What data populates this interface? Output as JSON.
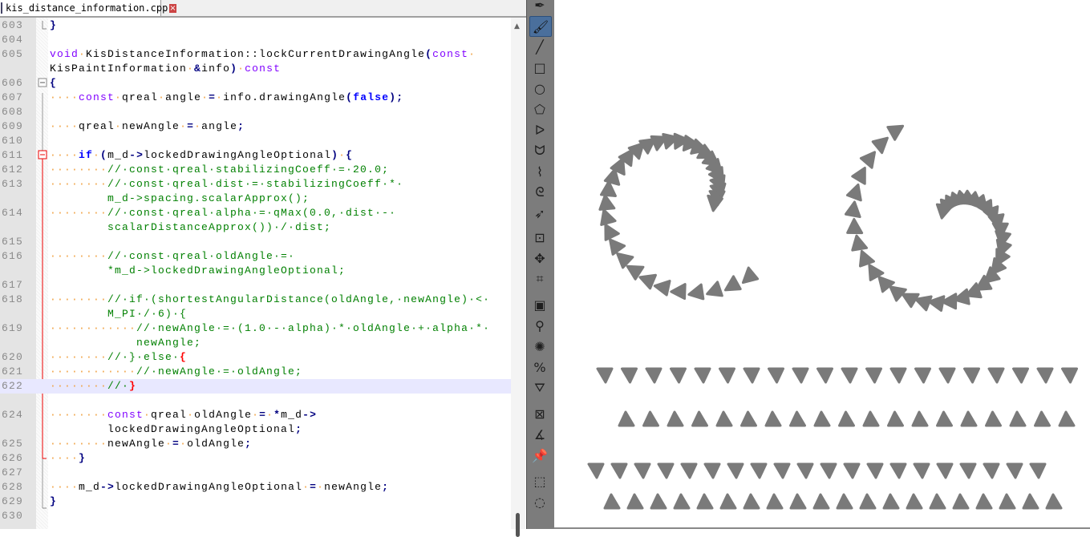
{
  "tab": {
    "filename": "kis_distance_information.cpp"
  },
  "colors": {
    "keyword": "#8000ff",
    "keyword_bold": "#0000ff",
    "comment": "#008000",
    "operator": "#000080",
    "whitespace": "#f0a040",
    "current_line": "#e8e8ff",
    "brush_dab": "#7a7a7a",
    "toolbox": "#7c7c7c",
    "active_tool": "#4a6f9c"
  },
  "code_rows": [
    {
      "n": "603",
      "s": [
        [
          "}",
          "op"
        ]
      ]
    },
    {
      "n": "604",
      "s": []
    },
    {
      "n": "605",
      "s": [
        [
          "void",
          "kw"
        ],
        [
          "·",
          "ws"
        ],
        [
          "KisDistanceInformation::lockCurrentDrawingAngle",
          "id"
        ],
        [
          "(",
          "op"
        ],
        [
          "const",
          "kw"
        ],
        [
          "·",
          "ws"
        ]
      ]
    },
    {
      "n": "",
      "s": [
        [
          "KisPaintInformation",
          "id"
        ],
        [
          "·",
          "ws"
        ],
        [
          "&",
          "op"
        ],
        [
          "info",
          "id"
        ],
        [
          ")",
          "op"
        ],
        [
          "·",
          "ws"
        ],
        [
          "const",
          "kw"
        ]
      ]
    },
    {
      "n": "606",
      "s": [
        [
          "{",
          "op"
        ]
      ]
    },
    {
      "n": "607",
      "s": [
        [
          "····",
          "ws"
        ],
        [
          "const",
          "kw"
        ],
        [
          "·",
          "ws"
        ],
        [
          "qreal",
          "id"
        ],
        [
          "·",
          "ws"
        ],
        [
          "angle",
          "id"
        ],
        [
          "·",
          "ws"
        ],
        [
          "=",
          "op"
        ],
        [
          "·",
          "ws"
        ],
        [
          "info.drawingAngle",
          "id"
        ],
        [
          "(",
          "op"
        ],
        [
          "false",
          "kb"
        ],
        [
          ");",
          "op"
        ]
      ]
    },
    {
      "n": "608",
      "s": []
    },
    {
      "n": "609",
      "s": [
        [
          "····",
          "ws"
        ],
        [
          "qreal",
          "id"
        ],
        [
          "·",
          "ws"
        ],
        [
          "newAngle",
          "id"
        ],
        [
          "·",
          "ws"
        ],
        [
          "=",
          "op"
        ],
        [
          "·",
          "ws"
        ],
        [
          "angle",
          "id"
        ],
        [
          ";",
          "op"
        ]
      ]
    },
    {
      "n": "610",
      "s": []
    },
    {
      "n": "611",
      "s": [
        [
          "····",
          "ws"
        ],
        [
          "if",
          "kb"
        ],
        [
          "·",
          "ws"
        ],
        [
          "(",
          "op"
        ],
        [
          "m_d",
          "id"
        ],
        [
          "->",
          "op"
        ],
        [
          "lockedDrawingAngleOptional",
          "id"
        ],
        [
          ")",
          "op"
        ],
        [
          "·",
          "ws"
        ],
        [
          "{",
          "op"
        ]
      ]
    },
    {
      "n": "612",
      "s": [
        [
          "········",
          "ws"
        ],
        [
          "//·const·qreal·stabilizingCoeff·=·20.0;",
          "cm"
        ]
      ]
    },
    {
      "n": "613",
      "s": [
        [
          "········",
          "ws"
        ],
        [
          "//·const·qreal·dist·=·stabilizingCoeff·*·",
          "cm"
        ]
      ]
    },
    {
      "n": "",
      "s": [
        [
          "        ",
          "id"
        ],
        [
          "m_d->spacing.scalarApprox();",
          "cm"
        ]
      ]
    },
    {
      "n": "614",
      "s": [
        [
          "········",
          "ws"
        ],
        [
          "//·const·qreal·alpha·=·qMax(0.0,·dist·-·",
          "cm"
        ]
      ]
    },
    {
      "n": "",
      "s": [
        [
          "        ",
          "id"
        ],
        [
          "scalarDistanceApprox())·/·dist;",
          "cm"
        ]
      ]
    },
    {
      "n": "615",
      "s": []
    },
    {
      "n": "616",
      "s": [
        [
          "········",
          "ws"
        ],
        [
          "//·const·qreal·oldAngle·=·",
          "cm"
        ]
      ]
    },
    {
      "n": "",
      "s": [
        [
          "        ",
          "id"
        ],
        [
          "*m_d->lockedDrawingAngleOptional;",
          "cm"
        ]
      ]
    },
    {
      "n": "617",
      "s": []
    },
    {
      "n": "618",
      "s": [
        [
          "········",
          "ws"
        ],
        [
          "//·if·(shortestAngularDistance(oldAngle,·newAngle)·<·",
          "cm"
        ]
      ]
    },
    {
      "n": "",
      "s": [
        [
          "        ",
          "id"
        ],
        [
          "M_PI·/·6)·{",
          "cm"
        ]
      ]
    },
    {
      "n": "619",
      "s": [
        [
          "············",
          "ws"
        ],
        [
          "//·newAngle·=·(1.0·-·alpha)·*·oldAngle·+·alpha·*·",
          "cm"
        ]
      ]
    },
    {
      "n": "",
      "s": [
        [
          "            ",
          "id"
        ],
        [
          "newAngle;",
          "cm"
        ]
      ]
    },
    {
      "n": "620",
      "s": [
        [
          "········",
          "ws"
        ],
        [
          "//·}·else·",
          "cm"
        ],
        [
          "{",
          "br"
        ]
      ]
    },
    {
      "n": "621",
      "s": [
        [
          "············",
          "ws"
        ],
        [
          "//·newAngle·=·oldAngle;",
          "cm"
        ]
      ]
    },
    {
      "n": "622",
      "s": [
        [
          "········",
          "ws"
        ],
        [
          "//·",
          "cm"
        ],
        [
          "}",
          "br"
        ]
      ],
      "current": true
    },
    {
      "n": "",
      "s": []
    },
    {
      "n": "624",
      "s": [
        [
          "········",
          "ws"
        ],
        [
          "const",
          "kw"
        ],
        [
          "·",
          "ws"
        ],
        [
          "qreal",
          "id"
        ],
        [
          "·",
          "ws"
        ],
        [
          "oldAngle",
          "id"
        ],
        [
          "·",
          "ws"
        ],
        [
          "=",
          "op"
        ],
        [
          "·",
          "ws"
        ],
        [
          "*",
          "op"
        ],
        [
          "m_d",
          "id"
        ],
        [
          "->",
          "op"
        ]
      ]
    },
    {
      "n": "",
      "s": [
        [
          "        ",
          "id"
        ],
        [
          "lockedDrawingAngleOptional",
          "id"
        ],
        [
          ";",
          "op"
        ]
      ]
    },
    {
      "n": "625",
      "s": [
        [
          "········",
          "ws"
        ],
        [
          "newAngle",
          "id"
        ],
        [
          "·",
          "ws"
        ],
        [
          "=",
          "op"
        ],
        [
          "·",
          "ws"
        ],
        [
          "oldAngle",
          "id"
        ],
        [
          ";",
          "op"
        ]
      ]
    },
    {
      "n": "626",
      "s": [
        [
          "····",
          "ws"
        ],
        [
          "}",
          "op"
        ]
      ]
    },
    {
      "n": "627",
      "s": []
    },
    {
      "n": "628",
      "s": [
        [
          "····",
          "ws"
        ],
        [
          "m_d",
          "id"
        ],
        [
          "->",
          "op"
        ],
        [
          "lockedDrawingAngleOptional",
          "id"
        ],
        [
          "·",
          "ws"
        ],
        [
          "=",
          "op"
        ],
        [
          "·",
          "ws"
        ],
        [
          "newAngle",
          "id"
        ],
        [
          ";",
          "op"
        ]
      ]
    },
    {
      "n": "629",
      "s": [
        [
          "}",
          "op"
        ]
      ]
    },
    {
      "n": "630",
      "s": []
    }
  ],
  "tools": [
    {
      "name": "calligraphy-tool",
      "glyph": "✒"
    },
    {
      "name": "freehand-brush-tool",
      "glyph": "🖌",
      "active": true
    },
    {
      "name": "line-tool",
      "glyph": "╱"
    },
    {
      "name": "rectangle-tool",
      "glyph": "□"
    },
    {
      "name": "ellipse-tool",
      "glyph": "○"
    },
    {
      "name": "polygon-tool",
      "glyph": "⬠"
    },
    {
      "name": "polyline-tool",
      "glyph": "ᐅ"
    },
    {
      "name": "bezier-curve-tool",
      "glyph": "ᗢ"
    },
    {
      "name": "freehand-path-tool",
      "glyph": "⌇"
    },
    {
      "name": "dynamic-brush-tool",
      "glyph": "ᘓ"
    },
    {
      "name": "multibrush-tool",
      "glyph": "➶"
    },
    {
      "name": "transform-tool",
      "glyph": "⊡"
    },
    {
      "name": "move-tool",
      "glyph": "✥"
    },
    {
      "name": "crop-tool",
      "glyph": "⌗"
    },
    {
      "name": "gradient-tool",
      "glyph": "▣"
    },
    {
      "name": "color-picker-tool",
      "glyph": "⚲"
    },
    {
      "name": "smart-patch-tool",
      "glyph": "✺"
    },
    {
      "name": "fill-tool-percent",
      "glyph": "%"
    },
    {
      "name": "fill-tool",
      "glyph": "⛛"
    },
    {
      "name": "assistant-tool",
      "glyph": "⊠"
    },
    {
      "name": "measure-tool",
      "glyph": "∡"
    },
    {
      "name": "reference-pin-tool",
      "glyph": "📌"
    },
    {
      "name": "rectangular-selection-tool",
      "glyph": "⬚"
    },
    {
      "name": "elliptical-selection-tool",
      "glyph": "◌"
    }
  ]
}
